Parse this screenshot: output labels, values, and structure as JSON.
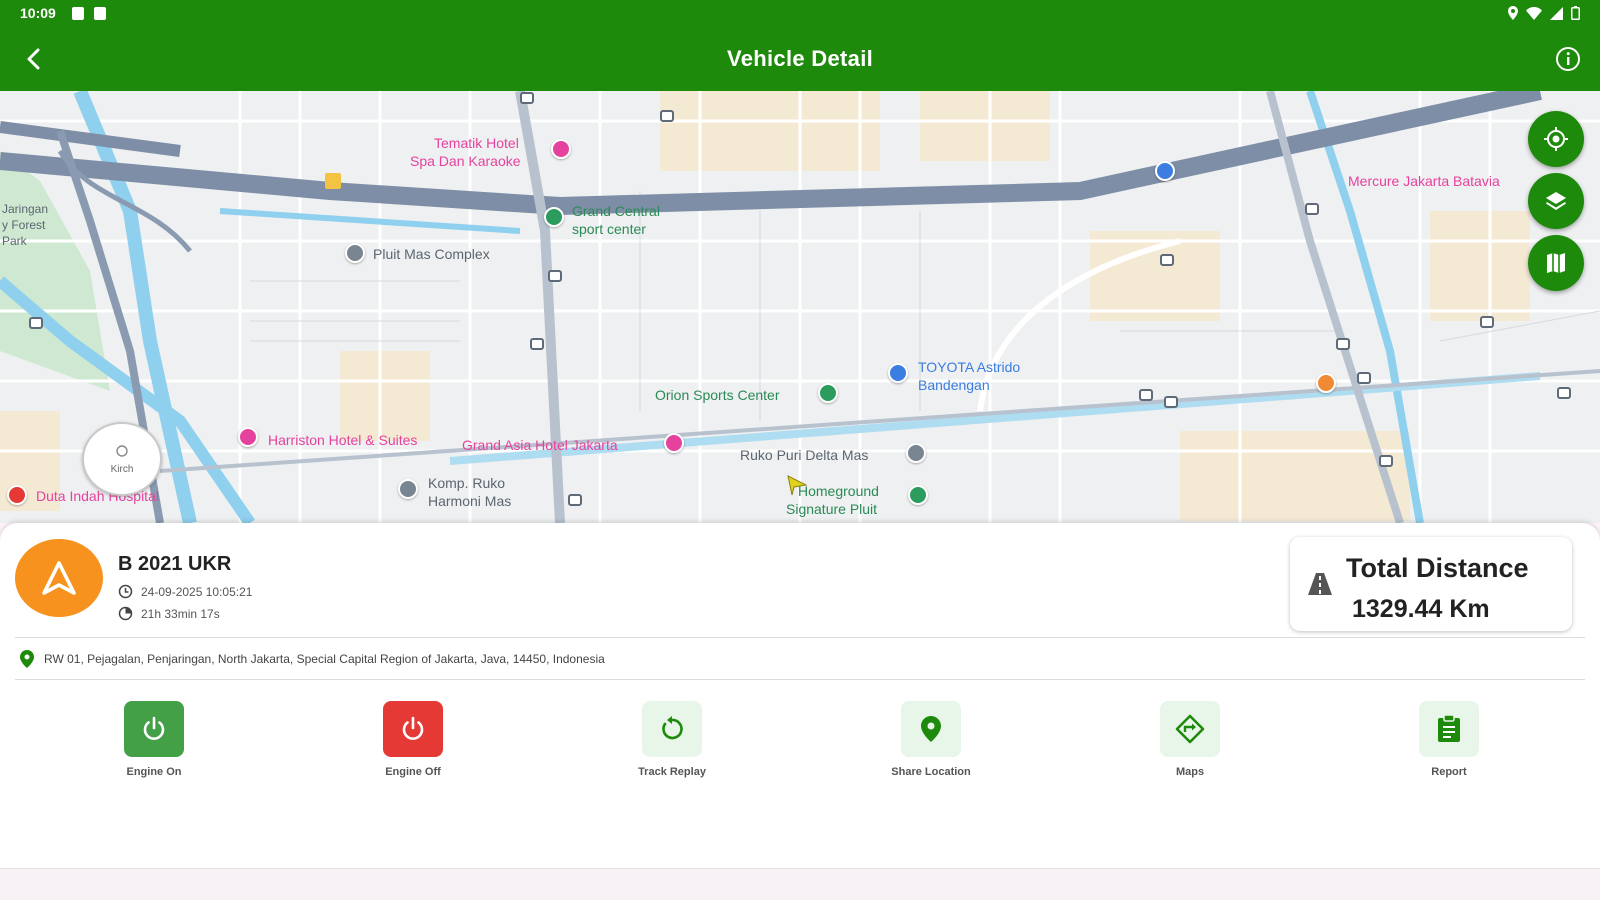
{
  "status_bar": {
    "time": "10:09"
  },
  "app_bar": {
    "title": "Vehicle Detail"
  },
  "map": {
    "pois": [
      {
        "label": "Tematik Hotel",
        "color": "pink"
      },
      {
        "label": "Spa Dan Karaoke",
        "color": "pink"
      },
      {
        "label": "Grand Central",
        "color": "green"
      },
      {
        "label": "sport center",
        "color": "green"
      },
      {
        "label": "Pluit Mas Complex",
        "color": "gray"
      },
      {
        "label": "Mercure Jakarta Batavia",
        "color": "pink"
      },
      {
        "label": "Orion Sports Center",
        "color": "green"
      },
      {
        "label": "TOYOTA Astrido",
        "color": "blue"
      },
      {
        "label": "Bandengan",
        "color": "blue"
      },
      {
        "label": "Harriston Hotel & Suites",
        "color": "pink"
      },
      {
        "label": "Grand Asia Hotel Jakarta",
        "color": "pink"
      },
      {
        "label": "Ruko Puri Delta Mas",
        "color": "gray"
      },
      {
        "label": "Komp. Ruko",
        "color": "gray"
      },
      {
        "label": "Harmoni Mas",
        "color": "gray"
      },
      {
        "label": "Homeground",
        "color": "green"
      },
      {
        "label": "Signature Pluit",
        "color": "green"
      },
      {
        "label": "Duta Indah Hospital",
        "color": "pink"
      },
      {
        "label": "Jaringan",
        "color": "gray"
      },
      {
        "label": "y Forest",
        "color": "gray"
      },
      {
        "label": "Park",
        "color": "gray"
      }
    ],
    "compass_label": "Kirch"
  },
  "vehicle": {
    "plate": "B 2021 UKR",
    "datetime": "24-09-2025 10:05:21",
    "duration": "21h 33min 17s",
    "address": "RW 01, Pejagalan, Penjaringan, North Jakarta, Special Capital Region of Jakarta, Java, 14450, Indonesia"
  },
  "distance": {
    "label": "Total Distance",
    "value": "1329.44 Km"
  },
  "actions": [
    {
      "label": "Engine On"
    },
    {
      "label": "Engine Off"
    },
    {
      "label": "Track Replay"
    },
    {
      "label": "Share Location"
    },
    {
      "label": "Maps"
    },
    {
      "label": "Report"
    }
  ],
  "colors": {
    "primary": "#1e8a0c",
    "engine_on": "#43a047",
    "engine_off": "#e53935",
    "action_tint": "#e8f5e9",
    "avatar": "#f7921e"
  }
}
